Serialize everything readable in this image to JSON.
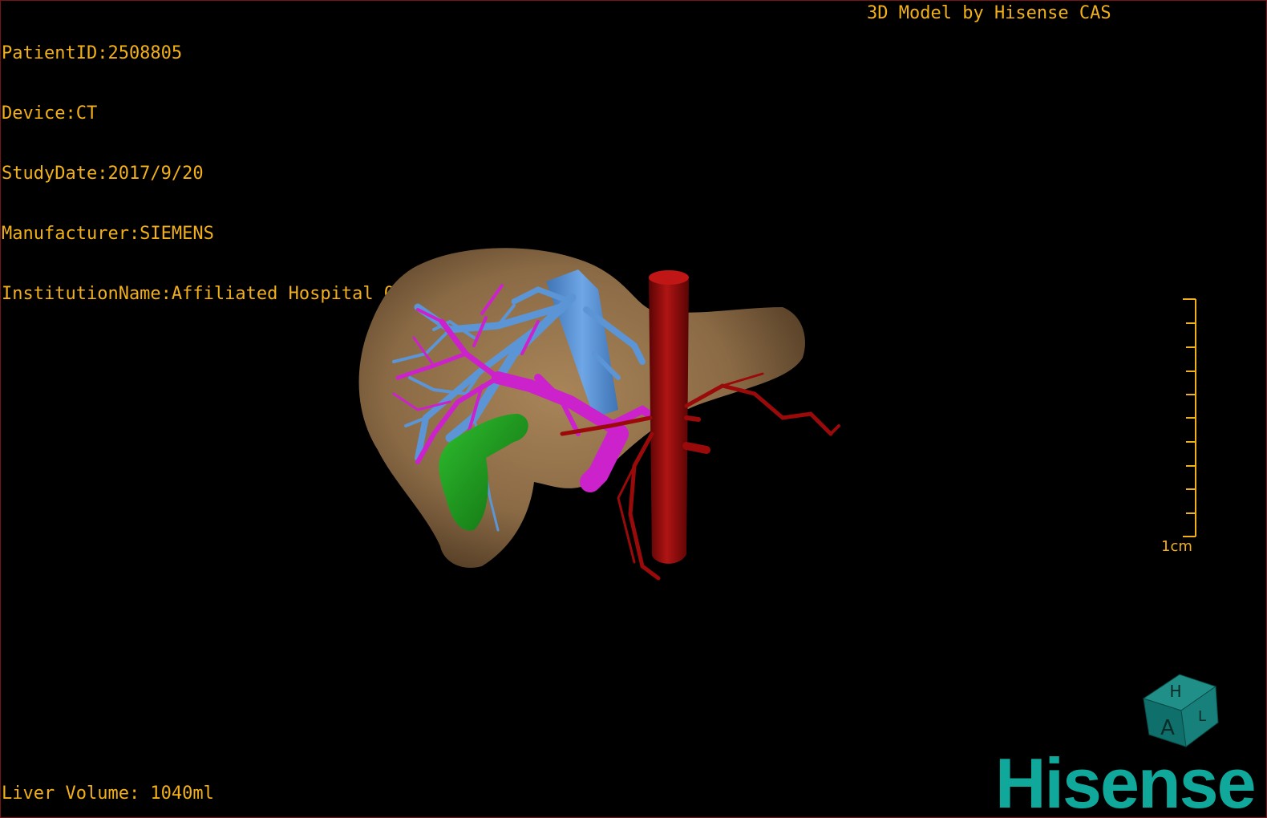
{
  "info": {
    "patient_id": "PatientID:2508805",
    "device": "Device:CT",
    "study_date": "StudyDate:2017/9/20",
    "manufacturer": "Manufacturer:SIEMENS",
    "institution": "InstitutionName:Affiliated Hospital Qingdao University-C"
  },
  "brand_caption": "3D Model by Hisense CAS",
  "liver_volume": "Liver Volume: 1040ml",
  "scale_bar": {
    "label": "1cm"
  },
  "orientation_cube": {
    "face_top": "H",
    "face_front": "A",
    "face_side": "L"
  },
  "logo": {
    "text": "Hisense"
  },
  "colors": {
    "overlay_text": "#f2b019",
    "liver": "#8a6a45",
    "hepatic_vein": "#5b95d6",
    "portal_vein": "#cc22cc",
    "aorta": "#9a0a0a",
    "gallbladder": "#1f9a1f",
    "logo": "#0fa89b",
    "border": "#7a1414"
  }
}
